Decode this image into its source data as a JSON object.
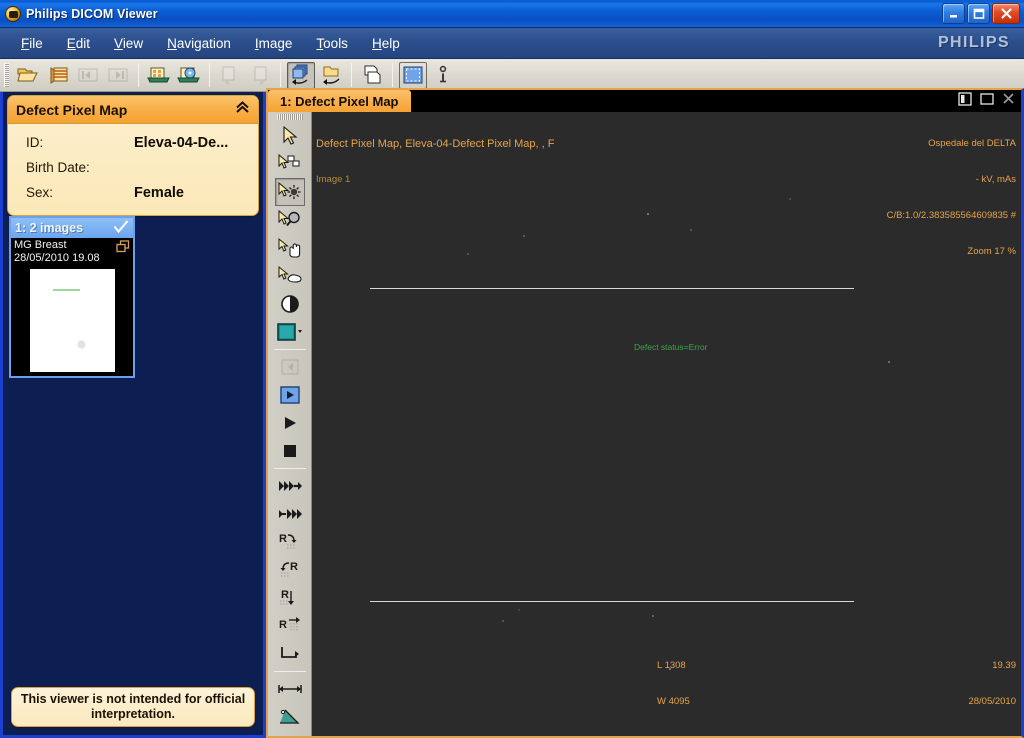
{
  "window": {
    "title": "Philips DICOM Viewer",
    "icon": "philips-app-icon",
    "buttons": {
      "minimize": "minimize-icon",
      "maximize": "maximize-icon",
      "close": "close-icon"
    }
  },
  "menubar": {
    "items": [
      {
        "label": "File",
        "mnemonic": "F"
      },
      {
        "label": "Edit",
        "mnemonic": "E"
      },
      {
        "label": "View",
        "mnemonic": "V"
      },
      {
        "label": "Navigation",
        "mnemonic": "N"
      },
      {
        "label": "Image",
        "mnemonic": "I"
      },
      {
        "label": "Tools",
        "mnemonic": "T"
      },
      {
        "label": "Help",
        "mnemonic": "H"
      }
    ],
    "brand": "PHILIPS"
  },
  "toolbar": {
    "buttons": [
      {
        "name": "open-folder-icon",
        "enabled": true
      },
      {
        "name": "open-list-icon",
        "enabled": true
      },
      {
        "name": "previous-icon",
        "enabled": false
      },
      {
        "name": "next-icon",
        "enabled": false
      },
      {
        "name": "export-media-icon",
        "enabled": true
      },
      {
        "name": "burn-cd-icon",
        "enabled": true
      },
      {
        "name": "copy-page-icon",
        "enabled": false
      },
      {
        "name": "paste-page-icon",
        "enabled": false
      },
      {
        "name": "layers-back-icon",
        "enabled": true,
        "active": true
      },
      {
        "name": "folder-back-icon",
        "enabled": true
      },
      {
        "name": "duplicate-icon",
        "enabled": true
      },
      {
        "name": "select-all-icon",
        "enabled": true,
        "boxed": true
      },
      {
        "name": "info-icon",
        "enabled": true
      }
    ]
  },
  "sidebar": {
    "patient": {
      "title": "Defect Pixel Map",
      "collapse_icon": "chevron-up-double-icon",
      "fields": [
        {
          "label": "ID:",
          "value": "Eleva-04-De..."
        },
        {
          "label": "Birth Date:",
          "value": ""
        },
        {
          "label": "Sex:",
          "value": "Female"
        }
      ]
    },
    "series": [
      {
        "header": "1: 2 images",
        "check_icon": "checkmark-icon",
        "modality": "MG Breast",
        "datetime": "28/05/2010 19.08",
        "multiframe_icon": "multiframe-icon"
      }
    ],
    "disclaimer": "This viewer is not intended for official interpretation."
  },
  "viewer": {
    "tab": {
      "label": "1: Defect Pixel Map"
    },
    "tab_controls": [
      {
        "name": "layout-panel-icon"
      },
      {
        "name": "maximize-panel-icon"
      },
      {
        "name": "close-panel-icon"
      }
    ],
    "tools": [
      {
        "name": "pointer-tool",
        "selected": false,
        "enabled": true
      },
      {
        "name": "select-series-tool",
        "selected": false,
        "enabled": true
      },
      {
        "name": "brightness-contrast-tool",
        "selected": true,
        "enabled": true
      },
      {
        "name": "magnifier-tool",
        "selected": false,
        "enabled": true
      },
      {
        "name": "pan-hand-tool",
        "selected": false,
        "enabled": true
      },
      {
        "name": "zoom-roll-tool",
        "selected": false,
        "enabled": true
      },
      {
        "name": "invert-contrast-tool",
        "selected": false,
        "enabled": true
      },
      {
        "name": "colormap-tool",
        "selected": false,
        "enabled": true,
        "dropdown": true
      },
      {
        "name": "cine-reverse-tool",
        "selected": false,
        "enabled": false
      },
      {
        "name": "cine-play-tool",
        "selected": true,
        "enabled": true
      },
      {
        "name": "cine-forward-tool",
        "selected": false,
        "enabled": true
      },
      {
        "name": "cine-stop-tool",
        "selected": false,
        "enabled": true
      },
      {
        "name": "fast-forward-tool",
        "selected": false,
        "enabled": true
      },
      {
        "name": "step-forward-tool",
        "selected": false,
        "enabled": true
      },
      {
        "name": "rotate-right-tool",
        "selected": false,
        "enabled": true
      },
      {
        "name": "rotate-left-tool",
        "selected": false,
        "enabled": true
      },
      {
        "name": "flip-vertical-tool",
        "selected": false,
        "enabled": true
      },
      {
        "name": "flip-horizontal-tool",
        "selected": false,
        "enabled": true
      },
      {
        "name": "reset-transform-tool",
        "selected": false,
        "enabled": true
      },
      {
        "name": "measure-distance-tool",
        "selected": false,
        "enabled": true
      },
      {
        "name": "measure-angle-tool",
        "selected": false,
        "enabled": true
      }
    ],
    "overlay": {
      "top_left_line1": "Defect Pixel Map, Eleva-04-Defect Pixel Map, , F",
      "top_left_line2": "Image 1",
      "top_right_line1": "Ospedale del DELTA",
      "top_right_line2": "- kV, mAs",
      "top_right_line3": "C/B:1.0/2.383585564609835 #",
      "top_right_line4": "Zoom 17 %",
      "bottom_left_line1": "L 1308",
      "bottom_left_line2": "W 4095",
      "bottom_right_line1": "19.39",
      "bottom_right_line2": "28/05/2010",
      "image_annotation": "Defect status=Error"
    },
    "colors": {
      "overlay_text": "#e7a34a",
      "annotation_text": "#3ea34c",
      "canvas_bg": "#2b2b2b",
      "accent": "#f5a233"
    }
  }
}
